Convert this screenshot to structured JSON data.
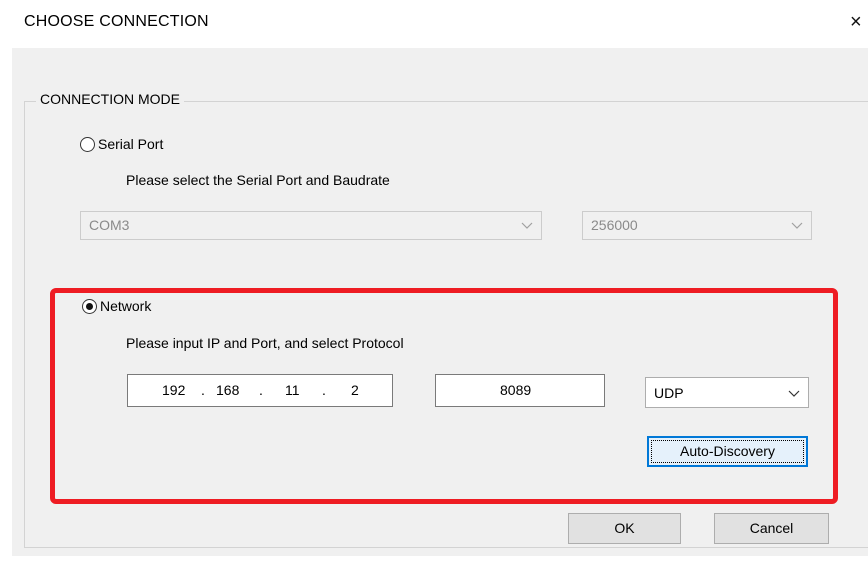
{
  "dialog": {
    "title": "CHOOSE CONNECTION",
    "close_glyph": "×"
  },
  "connection_mode": {
    "legend": "CONNECTION MODE",
    "serial": {
      "label": "Serial Port",
      "selected": false,
      "hint": "Please select the Serial Port and Baudrate",
      "port": "COM3",
      "baudrate": "256000"
    },
    "network": {
      "label": "Network",
      "selected": true,
      "hint": "Please  input IP and Port, and select Protocol",
      "ip": [
        "192",
        "168",
        "11",
        "2"
      ],
      "ip_separator": ".",
      "port": "8089",
      "protocol": "UDP",
      "auto_discovery_label": "Auto-Discovery"
    }
  },
  "buttons": {
    "ok": "OK",
    "cancel": "Cancel"
  },
  "annotation": {
    "highlight_color": "#ee1c23"
  },
  "icons": {
    "close": "close-icon",
    "dropdown": "chevron-down-icon"
  }
}
